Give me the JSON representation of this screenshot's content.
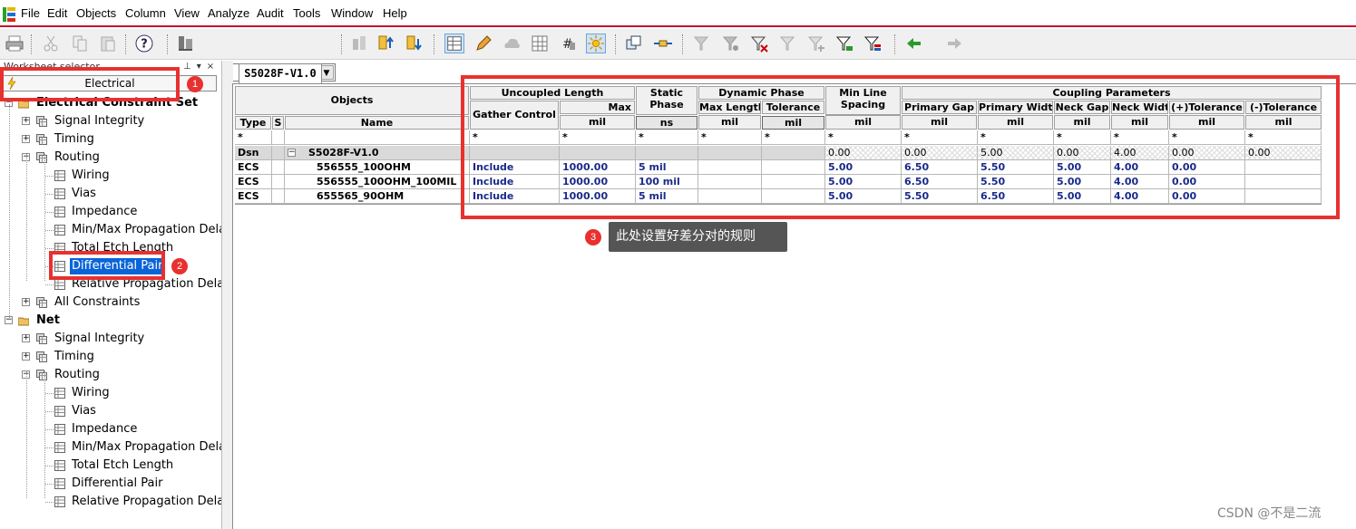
{
  "menubar": {
    "items": [
      "File",
      "Edit",
      "Objects",
      "Column",
      "View",
      "Analyze",
      "Audit",
      "Tools",
      "Window",
      "Help"
    ]
  },
  "toolbar": {
    "combo_value": "",
    "icons": [
      "print-icon",
      "cut-icon",
      "copy-icon",
      "paste-icon",
      "help-icon",
      "find-icon",
      "import-icon",
      "analyze-up-icon",
      "analyze-down-icon",
      "worksheet-icon",
      "edit-icon",
      "cloud-icon",
      "grid-icon",
      "hash-icon",
      "sun-icon",
      "windows-icon",
      "link-icon",
      "filter-icon",
      "filter-off-icon",
      "filter-clear-icon",
      "filter-remove-icon",
      "filter-add-icon",
      "filter-check-icon",
      "filter-color-icon",
      "back-icon",
      "forward-icon"
    ]
  },
  "left_panel": {
    "title": "Worksheet selector",
    "electrical_label": "Electrical",
    "tree": [
      {
        "label": "Electrical Constraint Set",
        "bold": true,
        "level": 0
      },
      {
        "label": "Signal Integrity",
        "level": 1
      },
      {
        "label": "Timing",
        "level": 1
      },
      {
        "label": "Routing",
        "level": 1
      },
      {
        "label": "Wiring",
        "level": 2
      },
      {
        "label": "Vias",
        "level": 2
      },
      {
        "label": "Impedance",
        "level": 2
      },
      {
        "label": "Min/Max Propagation Delay",
        "level": 2
      },
      {
        "label": "Total Etch Length",
        "level": 2
      },
      {
        "label": "Differential Pair",
        "level": 2,
        "selected": true
      },
      {
        "label": "Relative Propagation Delay",
        "level": 2
      },
      {
        "label": "All Constraints",
        "level": 1
      },
      {
        "label": "Net",
        "bold": true,
        "level": 0
      },
      {
        "label": "Signal Integrity",
        "level": 1
      },
      {
        "label": "Timing",
        "level": 1
      },
      {
        "label": "Routing",
        "level": 1
      },
      {
        "label": "Wiring",
        "level": 2
      },
      {
        "label": "Vias",
        "level": 2
      },
      {
        "label": "Impedance",
        "level": 2
      },
      {
        "label": "Min/Max Propagation Delay",
        "level": 2
      },
      {
        "label": "Total Etch Length",
        "level": 2
      },
      {
        "label": "Differential Pair",
        "level": 2
      },
      {
        "label": "Relative Propagation Delay",
        "level": 2
      }
    ]
  },
  "annotations": {
    "badge1": "1",
    "badge2": "2",
    "badge3": "3",
    "tooltip": "此处设置好差分对的规则"
  },
  "tab": {
    "label": "S5028F-V1.0"
  },
  "table": {
    "headers": {
      "objects": "Objects",
      "type": "Type",
      "s": "S",
      "name": "Name",
      "uncoupled_length": "Uncoupled Length",
      "gather_control": "Gather Control",
      "max": "Max",
      "static_phase": "Static Phase",
      "dynamic_phase": "Dynamic Phase",
      "max_length": "Max Length",
      "tolerance": "Tolerance",
      "min_line_spacing": "Min Line Spacing",
      "coupling_parameters": "Coupling Parameters",
      "primary_gap": "Primary Gap",
      "primary_width": "Primary Width",
      "neck_gap": "Neck Gap",
      "neck_width": "Neck Widt",
      "plus_tol": "(+)Tolerance",
      "minus_tol": "(-)Tolerance"
    },
    "units": {
      "max": "mil",
      "static_phase": "ns",
      "max_length": "mil",
      "tolerance": "mil",
      "min_line_spacing": "mil",
      "primary_gap": "mil",
      "primary_width": "mil",
      "neck_gap": "mil",
      "neck_width": "mil",
      "plus_tol": "mil",
      "minus_tol": "mil"
    },
    "filter": "*",
    "rows": [
      {
        "type": "Dsn",
        "name": "S5028F-V1.0",
        "gather": "",
        "max": "",
        "static": "",
        "dmax": "",
        "dtol": "",
        "minspace": "0.00",
        "pgap": "0.00",
        "pwidth": "5.00",
        "ngap": "0.00",
        "nwidth": "4.00",
        "ptol": "0.00",
        "mtol": "0.00"
      },
      {
        "type": "ECS",
        "name": "556555_100OHM",
        "gather": "Include",
        "max": "1000.00",
        "static": "5 mil",
        "dmax": "",
        "dtol": "",
        "minspace": "5.00",
        "pgap": "6.50",
        "pwidth": "5.50",
        "ngap": "5.00",
        "nwidth": "4.00",
        "ptol": "0.00",
        "mtol": ""
      },
      {
        "type": "ECS",
        "name": "556555_100OHM_100MIL",
        "gather": "Include",
        "max": "1000.00",
        "static": "100 mil",
        "dmax": "",
        "dtol": "",
        "minspace": "5.00",
        "pgap": "6.50",
        "pwidth": "5.50",
        "ngap": "5.00",
        "nwidth": "4.00",
        "ptol": "0.00",
        "mtol": ""
      },
      {
        "type": "ECS",
        "name": "655565_90OHM",
        "gather": "Include",
        "max": "1000.00",
        "static": "5 mil",
        "dmax": "",
        "dtol": "",
        "minspace": "5.00",
        "pgap": "5.50",
        "pwidth": "6.50",
        "ngap": "5.00",
        "nwidth": "4.00",
        "ptol": "0.00",
        "mtol": ""
      }
    ]
  },
  "watermark": "CSDN @不是二流",
  "colors": {
    "highlight_red": "#e8312f",
    "selection_blue": "#0a64d8",
    "value_blue": "#1a2a8a",
    "menu_border": "#c8102e"
  }
}
